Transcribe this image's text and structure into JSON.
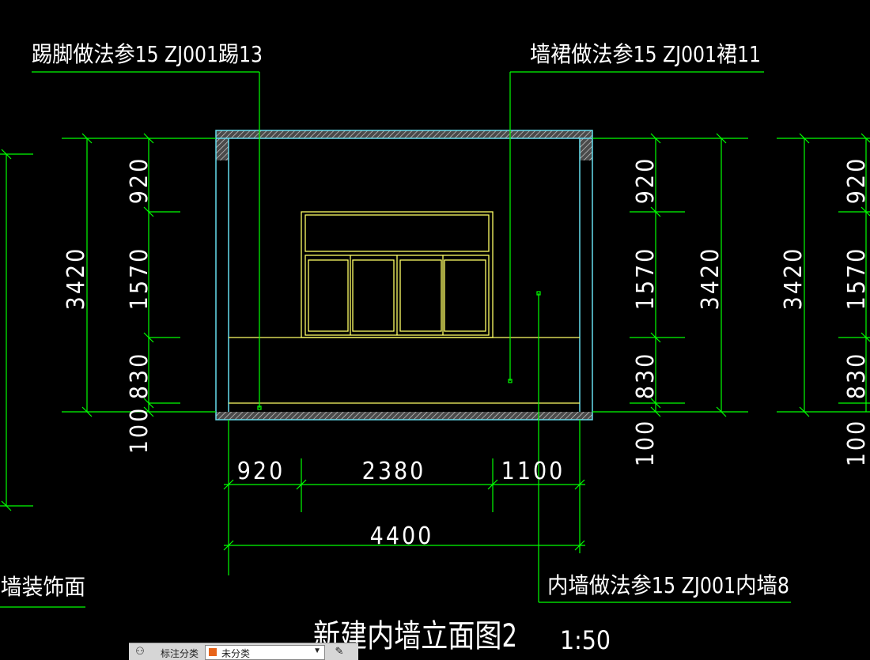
{
  "drawing": {
    "title": "新建内墙立面图2",
    "scale": "1:50",
    "notes": {
      "skirting": "踢脚做法参15 ZJ001踢13",
      "dado": "墙裙做法参15 ZJ001裙11",
      "inner_wall": "内墙做法参15 ZJ001内墙8",
      "decoration": "内墙装饰面"
    },
    "vertical_dims": {
      "top": "920",
      "middle": "1570",
      "bottom": "830",
      "base": "100",
      "total": "3420"
    },
    "horizontal_dims": {
      "left": "920",
      "middle": "2380",
      "right": "1100",
      "total": "4400"
    }
  },
  "toolbar": {
    "label": "标注分类",
    "selected": "未分类",
    "swatch_color": "#e8641a"
  },
  "colors": {
    "background": "#000000",
    "dimension": "#00ff00",
    "wall": "#66ddee",
    "window": "#ffff66",
    "text": "#ffffff"
  }
}
